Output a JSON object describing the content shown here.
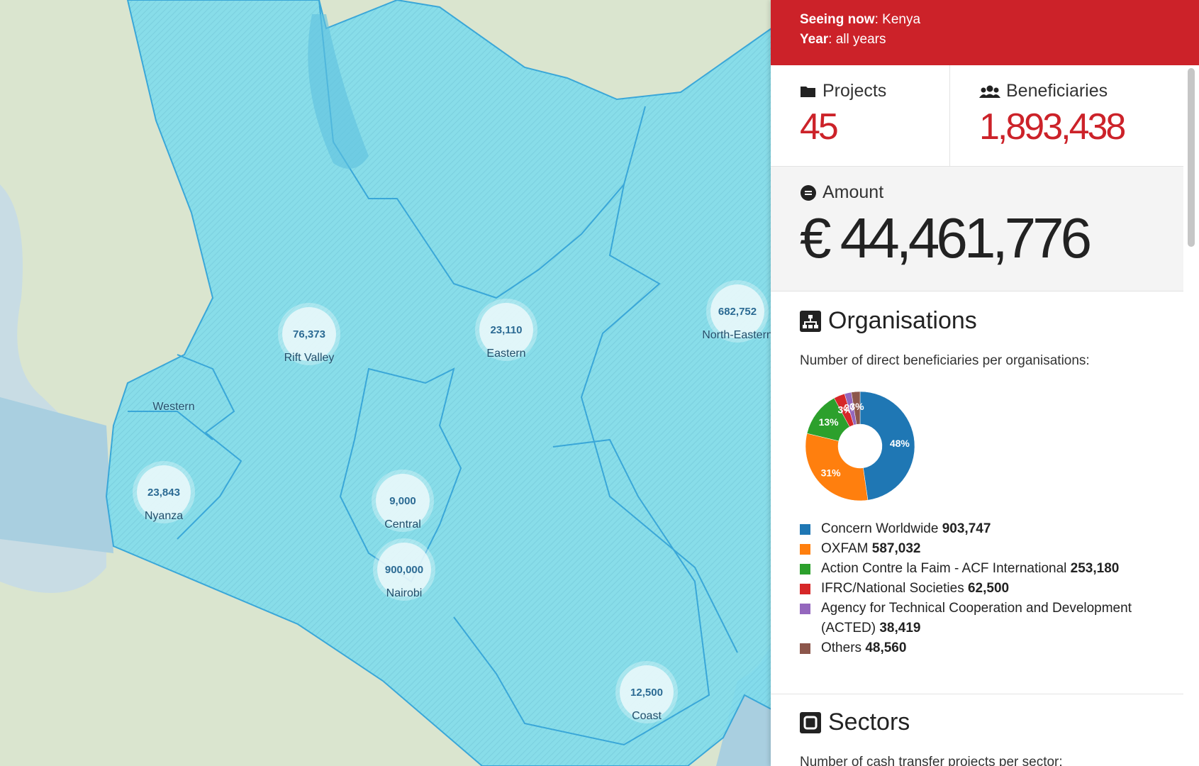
{
  "map": {
    "markers": [
      {
        "value": "76,373",
        "region": "Rift Valley"
      },
      {
        "value": "23,110",
        "region": "Eastern"
      },
      {
        "value": "682,752",
        "region": "North-Eastern"
      },
      {
        "value": "23,843",
        "region": "Nyanza"
      },
      {
        "value": "9,000",
        "region": "Central"
      },
      {
        "value": "900,000",
        "region": "Nairobi"
      },
      {
        "value": "12,500",
        "region": "Coast"
      }
    ],
    "labels": {
      "western": "Western"
    },
    "colors": {
      "water": "#a9cfe0",
      "land": "#d9e6cf",
      "region_fill": "#7fdcec",
      "region_border": "#3aa7d8"
    }
  },
  "banner": {
    "seeing_label": "Seeing now",
    "seeing_value": "Kenya",
    "year_label": "Year",
    "year_value": "all years"
  },
  "stats": {
    "projects_label": "Projects",
    "projects_value": "45",
    "beneficiaries_label": "Beneficiaries",
    "beneficiaries_value": "1,893,438",
    "amount_label": "Amount",
    "amount_value": "€ 44,461,776"
  },
  "organisations": {
    "title": "Organisations",
    "subtitle": "Number of direct beneficiaries per organisations:",
    "items": [
      {
        "name": "Concern Worldwide",
        "value": "903,747"
      },
      {
        "name": "OXFAM",
        "value": "587,032"
      },
      {
        "name": "Action Contre la Faim - ACF International",
        "value": "253,180"
      },
      {
        "name": "IFRC/National Societies",
        "value": "62,500"
      },
      {
        "name": "Agency for Technical Cooperation and Development (ACTED)",
        "value": "38,419"
      },
      {
        "name": "Others",
        "value": "48,560"
      }
    ]
  },
  "sectors": {
    "title": "Sectors",
    "subtitle": "Number of cash transfer projects per sector:"
  },
  "chart_data": {
    "type": "pie",
    "categories": [
      "Concern Worldwide",
      "OXFAM",
      "Action Contre la Faim - ACF International",
      "IFRC/National Societies",
      "Agency for Technical Cooperation and Development (ACTED)",
      "Others"
    ],
    "values": [
      903747,
      587032,
      253180,
      62500,
      38419,
      48560
    ],
    "labels": [
      "48%",
      "31%",
      "13%",
      "3%",
      "2%",
      "3%"
    ],
    "colors": [
      "#1f77b4",
      "#ff7f0e",
      "#2ca02c",
      "#d62728",
      "#9467bd",
      "#8c564b"
    ]
  }
}
